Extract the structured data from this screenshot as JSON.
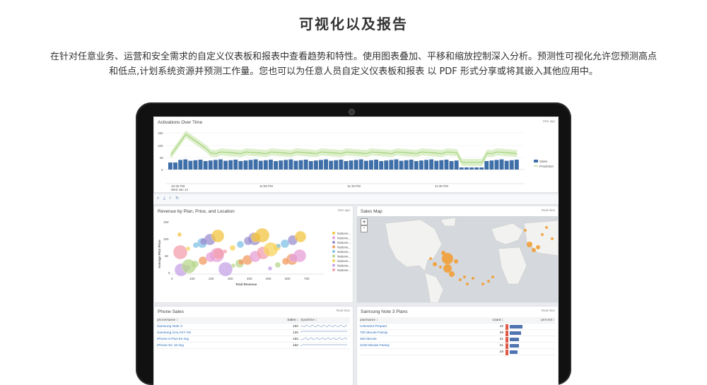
{
  "heading": "可视化以及报告",
  "description": "在针对任意业务、运营和安全需求的自定义仪表板和报表中查看趋势和特性。使用图表叠加、平移和缩放控制深入分析。预测性可视化允许您预测高点和低点,计划系统资源并预测工作量。您也可以为任意人员自定义仪表板和报表 以 PDF 形式分享或将其嵌入其他应用中。",
  "colors": {
    "sales": "#3f6fa8",
    "prediction": "#9ccf6e",
    "map_dot": "#f39c2d",
    "bar_accent": "#e05a47"
  },
  "activations": {
    "title": "Activations Over Time",
    "stamp": "19m ago",
    "legend": [
      "Sales",
      "Prediction"
    ],
    "x_labels": [
      "10:45 PM",
      "Wed Jan 14",
      "2015",
      "11:00 PM",
      "11:15 PM",
      "11:30 PM"
    ]
  },
  "toolbar_icons": [
    "zoom-icon",
    "download-icon",
    "info-icon",
    "refresh-icon"
  ],
  "bubble": {
    "title": "Revenue by Plan, Price, and Location",
    "stamp": "19m ago",
    "ylabel": "Average Plan Price",
    "xlabel": "Total Revenue",
    "legend": [
      "Natione...",
      "Natione...",
      "Natione...",
      "Natione...",
      "Natione...",
      "Natione...",
      "Natione...",
      "Natione...",
      "Natione..."
    ]
  },
  "sales_map": {
    "title": "Sales Map",
    "stamp": "Real-time",
    "zoom_in": "+",
    "zoom_out": "-"
  },
  "phone_sales": {
    "title": "Phone Sales",
    "stamp": "Real-time",
    "headers": [
      "phoneName ↕",
      "Sales ↕",
      "Sparkline ↕"
    ],
    "rows": [
      {
        "name": "Samsung Note 3",
        "sales": "190"
      },
      {
        "name": "Samsung GALAXY S5",
        "sales": "130"
      },
      {
        "name": "iPhone 6 Plus 64 Gig",
        "sales": "150"
      },
      {
        "name": "iPhone 5C 16 Gig",
        "sales": "160"
      }
    ]
  },
  "note3_plans": {
    "title": "Samsung Note 3 Plans",
    "stamp": "Real-time",
    "headers": [
      "planName ↕",
      "count ↕",
      "percent ↕"
    ],
    "rows": [
      {
        "name": "Unlimited Prepaid",
        "count": "42",
        "percent": 0.22
      },
      {
        "name": "700 Minute Family",
        "count": "39",
        "percent": 0.2
      },
      {
        "name": "450 Minute",
        "count": "31",
        "percent": 0.16
      },
      {
        "name": "2100 Minute Family",
        "count": "31",
        "percent": 0.16
      },
      {
        "name": "",
        "count": "28",
        "percent": 0.14
      }
    ]
  }
}
